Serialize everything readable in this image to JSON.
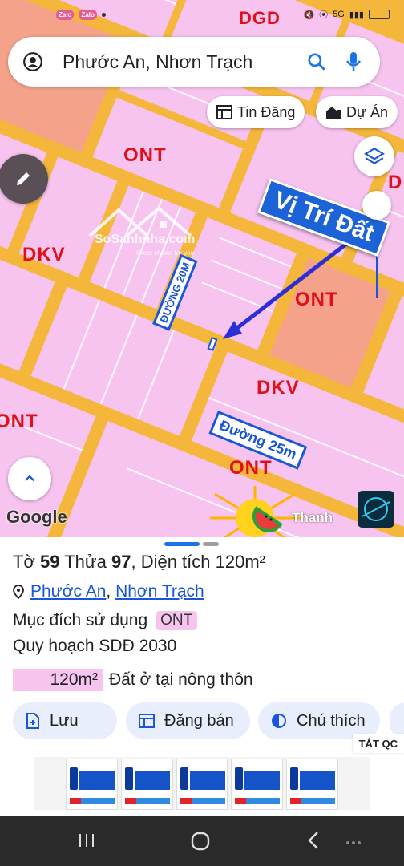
{
  "status_bar": {
    "carrier": "DGD",
    "apps": [
      "Zalo",
      "Zalo"
    ],
    "network": "5G"
  },
  "search": {
    "query": "Phước An, Nhơn Trạch"
  },
  "map_buttons": {
    "listings": "Tin Đăng",
    "projects": "Dự Án"
  },
  "map_labels": {
    "ont_1": "ONT",
    "ont_2": "ONT",
    "ont_3": "ONT",
    "ont_4": "ONT",
    "dkv_1": "DKV",
    "dkv_2": "DKV",
    "dgd": "DGD",
    "d_partial": "D",
    "road_20": "ĐƯỜNG 20M",
    "road_25": "Đường 25m",
    "location": "Vị Trí Đất",
    "watermark": "SoSanhnha.com",
    "watermark_tagline": "Great choice for you",
    "google": "Google",
    "owner": "Thanh"
  },
  "parcel": {
    "sheet_label": "Tờ",
    "sheet": "59",
    "lot_label": "Thửa",
    "lot": "97",
    "area_label": "Diện tích",
    "area": "120m²",
    "ward": "Phước An",
    "district": "Nhơn Trạch",
    "purpose_label": "Mục đích sử dụng",
    "purpose_code": "ONT",
    "plan_label": "Quy hoạch SDĐ 2030",
    "plan_area": "120m²",
    "plan_desc": "Đất ở tại nông thôn"
  },
  "actions": {
    "save": "Lưu",
    "post": "Đăng bán",
    "legend": "Chú thích"
  },
  "ad": {
    "close": "TẮT QC"
  },
  "colors": {
    "land_pink": "#f7c3ef",
    "road_orange": "#f4b63b",
    "dkv_salmon": "#f4a38a",
    "accent_blue": "#1a56d6",
    "label_red": "#e0101a"
  }
}
